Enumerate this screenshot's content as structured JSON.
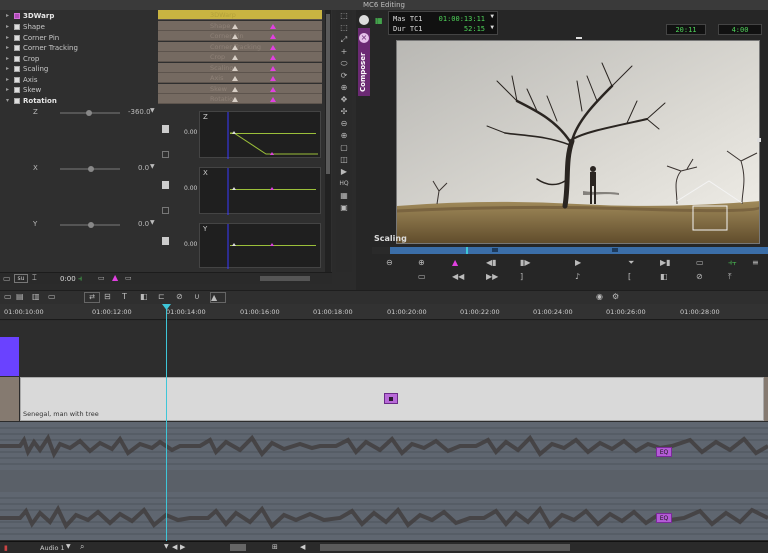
{
  "window": {
    "title": "MC6 Editing"
  },
  "effect_editor": {
    "parameters": [
      {
        "label": "3DWarp",
        "ghost": "3DWarp",
        "bold": true
      },
      {
        "label": "Shape",
        "ghost": "Shape"
      },
      {
        "label": "Corner Pin",
        "ghost": "Corner Pin"
      },
      {
        "label": "Corner Tracking",
        "ghost": "Corner Tracking"
      },
      {
        "label": "Crop",
        "ghost": "Crop"
      },
      {
        "label": "Scaling",
        "ghost": "Scaling"
      },
      {
        "label": "Axis",
        "ghost": "Axis"
      },
      {
        "label": "Skew",
        "ghost": "Skew"
      },
      {
        "label": "Rotation",
        "ghost": "Rotation",
        "bold": true
      }
    ],
    "rotation": {
      "z": {
        "label": "Z",
        "value": "-360.0",
        "graph_label": "Z",
        "graph_value": "0.00"
      },
      "x": {
        "label": "X",
        "value": "0.0",
        "graph_label": "X",
        "graph_value": "0.00"
      },
      "y": {
        "label": "Y",
        "value": "0.0",
        "graph_label": "Y",
        "graph_value": "0.00"
      }
    },
    "bottom": {
      "timecode": "0:00",
      "mode_label": "su"
    }
  },
  "composer": {
    "tab_label": "Composer",
    "mas_label": "Mas TC1",
    "mas_value": "01:00:13:11",
    "dur_label": "Dur TC1",
    "dur_value": "52:15",
    "tc_right_1": "20:11",
    "tc_right_2": "4:00",
    "overlay_label": "Scaling"
  },
  "timeline": {
    "ruler": [
      "01:00:10:00",
      "01:00:12:00",
      "01:00:14:00",
      "01:00:16:00",
      "01:00:18:00",
      "01:00:20:00",
      "01:00:22:00",
      "01:00:24:00",
      "01:00:26:00",
      "01:00:28:00"
    ],
    "video_clip_name": "Senegal, man with tree",
    "eq_label": "EQ",
    "status_track": "Audio 1"
  },
  "colors": {
    "accent_cyan": "#3ec6d8",
    "keyframe_magenta": "#e040e0",
    "clip_purple": "#6a42ff",
    "timecode_green": "#4fd35a"
  }
}
